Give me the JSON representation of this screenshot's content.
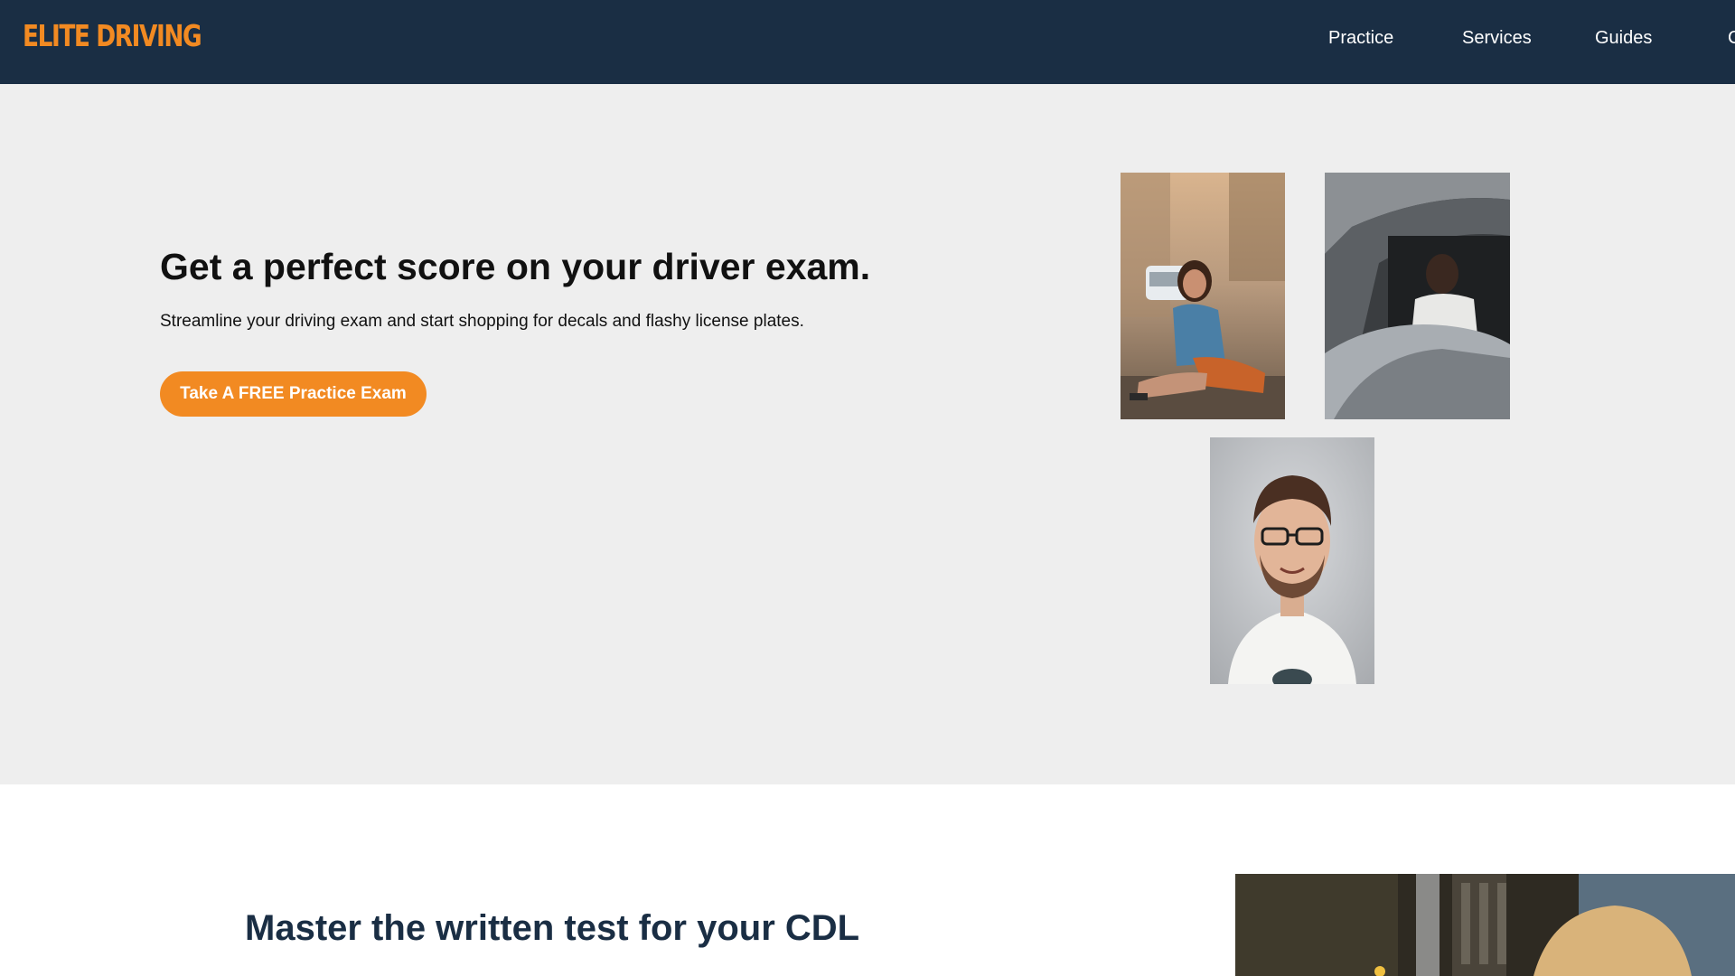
{
  "header": {
    "logo_text": "ELITE DRIVING",
    "nav": [
      {
        "label": "Practice"
      },
      {
        "label": "Services"
      },
      {
        "label": "Guides"
      },
      {
        "label": "C"
      }
    ]
  },
  "hero": {
    "title": "Get a perfect score on your driver exam.",
    "subtitle": "Streamline your driving exam and start shopping for decals and flashy license plates.",
    "cta_label": "Take A FREE Practice Exam",
    "photos": [
      {
        "subject": "woman sitting on curb in denim jacket"
      },
      {
        "subject": "young man in car driver seat"
      },
      {
        "subject": "smiling man with glasses portrait"
      }
    ]
  },
  "section2": {
    "title": "Master the written test for your CDL",
    "photo_subject": "man outdoors"
  },
  "colors": {
    "header_bg": "#1a2e44",
    "accent": "#f28a22",
    "hero_bg": "#eeeeee",
    "heading_dark": "#1a2e44"
  }
}
